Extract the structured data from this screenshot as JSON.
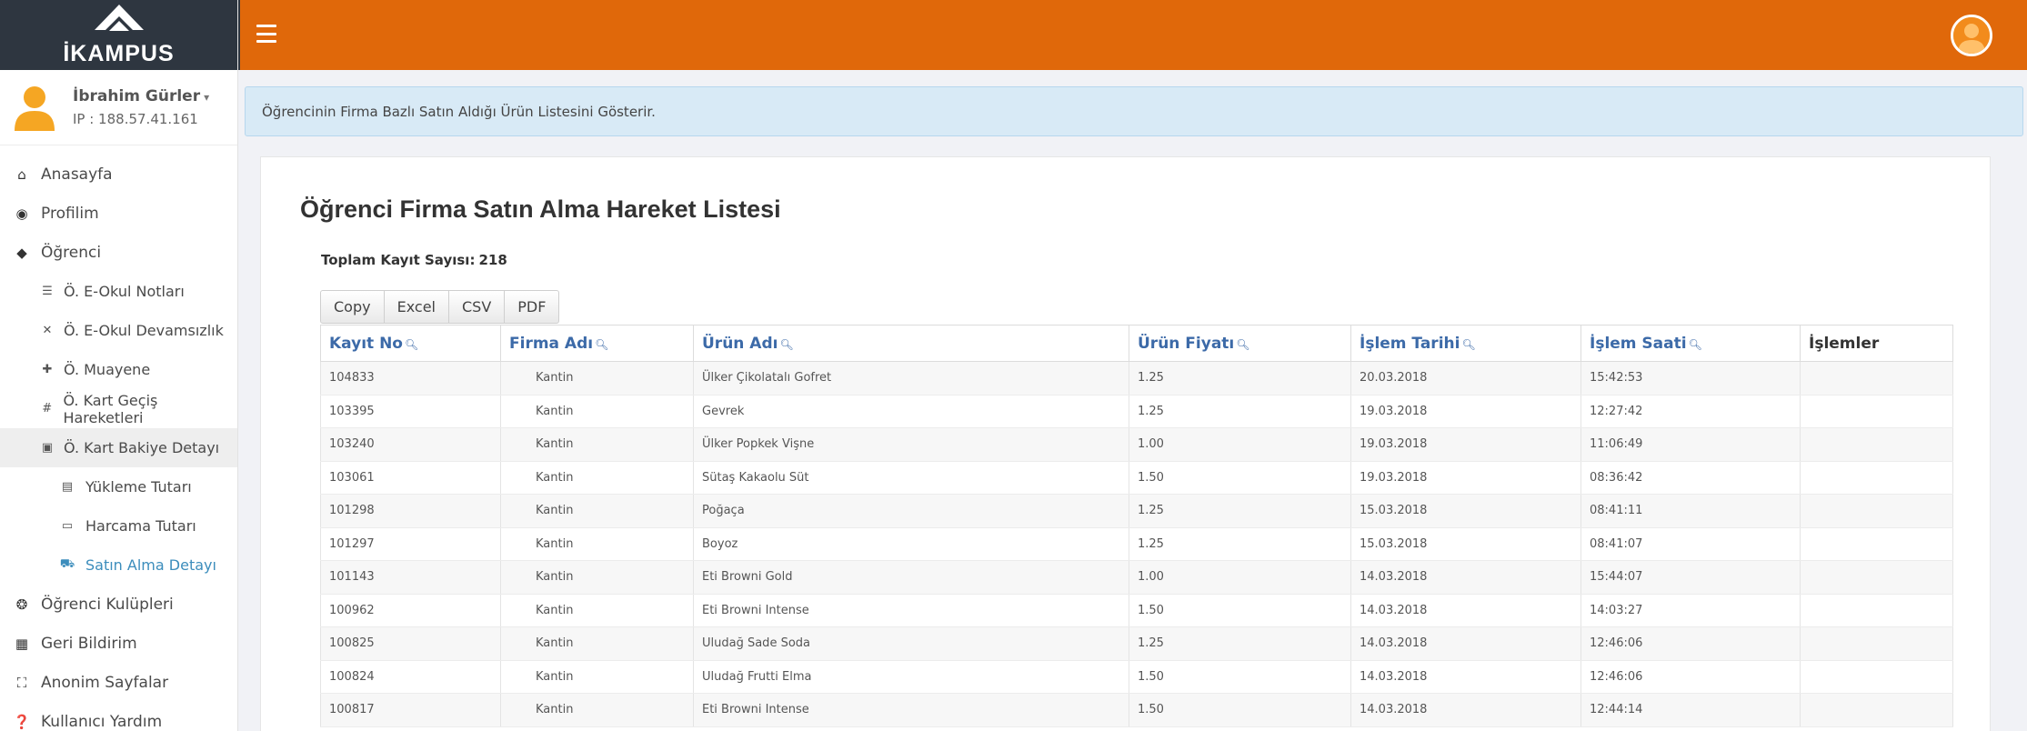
{
  "sidebar": {
    "logo_text": "İKAMPUS",
    "user": {
      "name": "İbrahim Gürler",
      "ip": "IP : 188.57.41.161"
    },
    "items": [
      {
        "label": "Anasayfa",
        "icon": "home-icon"
      },
      {
        "label": "Profilim",
        "icon": "user-circle-icon"
      },
      {
        "label": "Öğrenci",
        "icon": "graduation-cap-icon"
      },
      {
        "label": "Ö. E-Okul Notları",
        "icon": "list-icon"
      },
      {
        "label": "Ö. E-Okul Devamsızlık",
        "icon": "times-icon"
      },
      {
        "label": "Ö. Muayene",
        "icon": "stethoscope-icon"
      },
      {
        "label": "Ö. Kart Geçiş Hareketleri",
        "icon": "grid-icon"
      },
      {
        "label": "Ö. Kart Bakiye Detayı",
        "icon": "card-icon"
      },
      {
        "label": "Yükleme Tutarı",
        "icon": "bill-icon"
      },
      {
        "label": "Harcama Tutarı",
        "icon": "credit-card-icon"
      },
      {
        "label": "Satın Alma Detayı",
        "icon": "cart-icon"
      },
      {
        "label": "Öğrenci Kulüpleri",
        "icon": "group-icon"
      },
      {
        "label": "Geri Bildirim",
        "icon": "feedback-icon"
      },
      {
        "label": "Anonim Sayfalar",
        "icon": "anonymous-icon"
      },
      {
        "label": "Kullanıcı Yardım",
        "icon": "question-icon"
      }
    ]
  },
  "info_text": "Öğrencinin Firma Bazlı Satın Aldığı Ürün Listesini Gösterir.",
  "main": {
    "title": "Öğrenci Firma Satın Alma Hareket Listesi",
    "total_label": "Toplam Kayıt Sayısı:",
    "total_value": "218",
    "export_buttons": [
      "Copy",
      "Excel",
      "CSV",
      "PDF"
    ],
    "columns": [
      "Kayıt No",
      "Firma Adı",
      "Ürün Adı",
      "Ürün Fiyatı",
      "İşlem Tarihi",
      "İşlem Saati",
      "İşlemler"
    ],
    "rows": [
      [
        "104833",
        "Kantin",
        "Ülker Çikolatalı Gofret",
        "1.25",
        "20.03.2018",
        "15:42:53",
        ""
      ],
      [
        "103395",
        "Kantin",
        "Gevrek",
        "1.25",
        "19.03.2018",
        "12:27:42",
        ""
      ],
      [
        "103240",
        "Kantin",
        "Ülker Popkek Vişne",
        "1.00",
        "19.03.2018",
        "11:06:49",
        ""
      ],
      [
        "103061",
        "Kantin",
        "Sütaş Kakaolu Süt",
        "1.50",
        "19.03.2018",
        "08:36:42",
        ""
      ],
      [
        "101298",
        "Kantin",
        "Poğaça",
        "1.25",
        "15.03.2018",
        "08:41:11",
        ""
      ],
      [
        "101297",
        "Kantin",
        "Boyoz",
        "1.25",
        "15.03.2018",
        "08:41:07",
        ""
      ],
      [
        "101143",
        "Kantin",
        "Eti Browni Gold",
        "1.00",
        "14.03.2018",
        "15:44:07",
        ""
      ],
      [
        "100962",
        "Kantin",
        "Eti Browni Intense",
        "1.50",
        "14.03.2018",
        "14:03:27",
        ""
      ],
      [
        "100825",
        "Kantin",
        "Uludağ Sade Soda",
        "1.25",
        "14.03.2018",
        "12:46:06",
        ""
      ],
      [
        "100824",
        "Kantin",
        "Uludağ Frutti Elma",
        "1.50",
        "14.03.2018",
        "12:46:06",
        ""
      ],
      [
        "100817",
        "Kantin",
        "Eti Browni Intense",
        "1.50",
        "14.03.2018",
        "12:44:14",
        ""
      ]
    ]
  },
  "colors": {
    "topbar": "#e0680a",
    "logo_bg": "#2e3640",
    "link": "#3c6aa8",
    "info_bg": "#d8eaf6"
  }
}
